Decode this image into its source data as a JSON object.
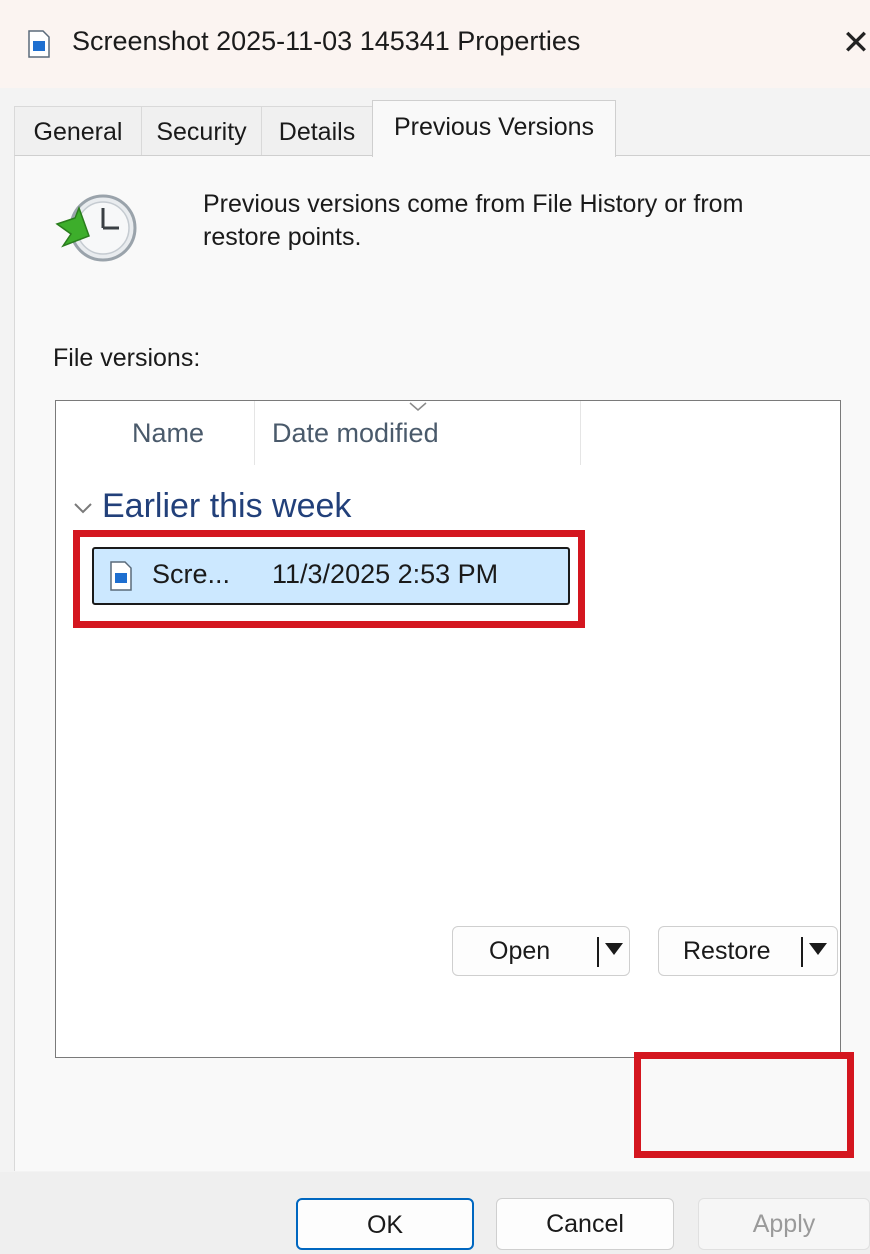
{
  "window": {
    "title": "Screenshot 2025-11-03 145341 Properties",
    "close_glyph": "✕"
  },
  "tabs": [
    {
      "label": "General"
    },
    {
      "label": "Security"
    },
    {
      "label": "Details"
    },
    {
      "label": "Previous Versions",
      "active": true
    }
  ],
  "panel": {
    "description": "Previous versions come from File History or from restore points.",
    "file_versions_label": "File versions:",
    "icon": "restore-clock-icon"
  },
  "list": {
    "columns": [
      {
        "label": "Name"
      },
      {
        "label": "Date modified",
        "sorted": "descending"
      }
    ],
    "groups": [
      {
        "label": "Earlier this week",
        "rows": [
          {
            "name": "Scre...",
            "date_modified": "11/3/2025 2:53 PM",
            "selected": true
          }
        ]
      }
    ]
  },
  "buttons": {
    "open": "Open",
    "restore": "Restore"
  },
  "footer": {
    "ok": "OK",
    "cancel": "Cancel",
    "apply": "Apply"
  },
  "colors": {
    "highlight": "#d4161f",
    "selection": "#cce8ff",
    "group_header": "#22407a",
    "primary_border": "#0067c0"
  }
}
